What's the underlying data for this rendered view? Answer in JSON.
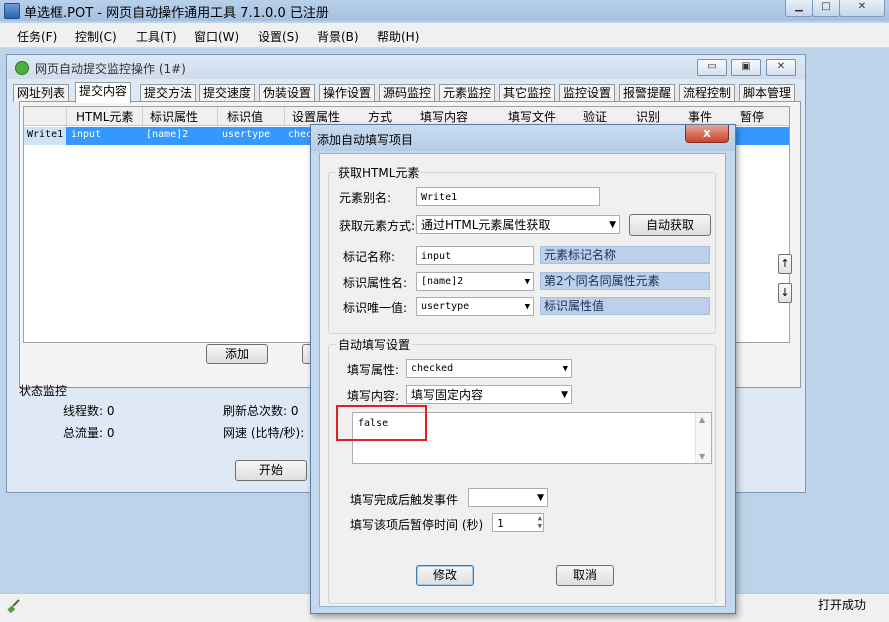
{
  "app": {
    "title": "单选框.POT - 网页自动操作通用工具 7.1.0.0 已注册"
  },
  "menu": [
    "任务(F)",
    "控制(C)",
    "工具(T)",
    "窗口(W)",
    "设置(S)",
    "背景(B)",
    "帮助(H)"
  ],
  "child": {
    "title": "网页自动提交监控操作 (1#)",
    "tabs": [
      "网址列表",
      "提交内容",
      "提交方法",
      "提交速度",
      "伪装设置",
      "操作设置",
      "源码监控",
      "元素监控",
      "其它监控",
      "监控设置",
      "报警提醒",
      "流程控制",
      "脚本管理"
    ],
    "selected_tab": "提交内容",
    "grid": {
      "columns": [
        "HTML元素",
        "标识属性",
        "标识值",
        "设置属性",
        "方式",
        "填写内容",
        "填写文件",
        "验证",
        "识别",
        "事件",
        "暂停"
      ],
      "row": [
        "Write1",
        "input",
        "[name]2",
        "usertype",
        "check"
      ]
    },
    "add_button": "添加",
    "start_button": "开始",
    "status": {
      "title": "状态监控",
      "threads_label": "线程数: 0",
      "refresh_label": "刷新总次数: 0",
      "traffic_label": "总流量: 0",
      "speed_label": "网速 (比特/秒):"
    }
  },
  "statusbar": {
    "text": "打开成功"
  },
  "dialog": {
    "title": "添加自动填写项目",
    "close": "x",
    "group_html": {
      "title": "获取HTML元素",
      "alias_label": "元素别名:",
      "alias_value": "Write1",
      "method_label": "获取元素方式:",
      "method_value": "通过HTML元素属性获取",
      "auto_button": "自动获取",
      "tag_label": "标记名称:",
      "tag_value": "input",
      "tag_hint": "元素标记名称",
      "attr_label": "标识属性名:",
      "attr_value": "[name]2",
      "attr_hint": "第2个同名同属性元素",
      "unique_label": "标识唯一值:",
      "unique_value": "usertype",
      "unique_hint": "标识属性值"
    },
    "group_fill": {
      "title": "自动填写设置",
      "prop_label": "填写属性:",
      "prop_value": "checked",
      "content_label": "填写内容:",
      "content_value": "填写固定内容",
      "text_value": "false",
      "event_label": "填写完成后触发事件",
      "event_value": "",
      "pause_label": "填写该项后暂停时间 (秒)",
      "pause_value": "1"
    },
    "modify_button": "修改",
    "cancel_button": "取消"
  }
}
